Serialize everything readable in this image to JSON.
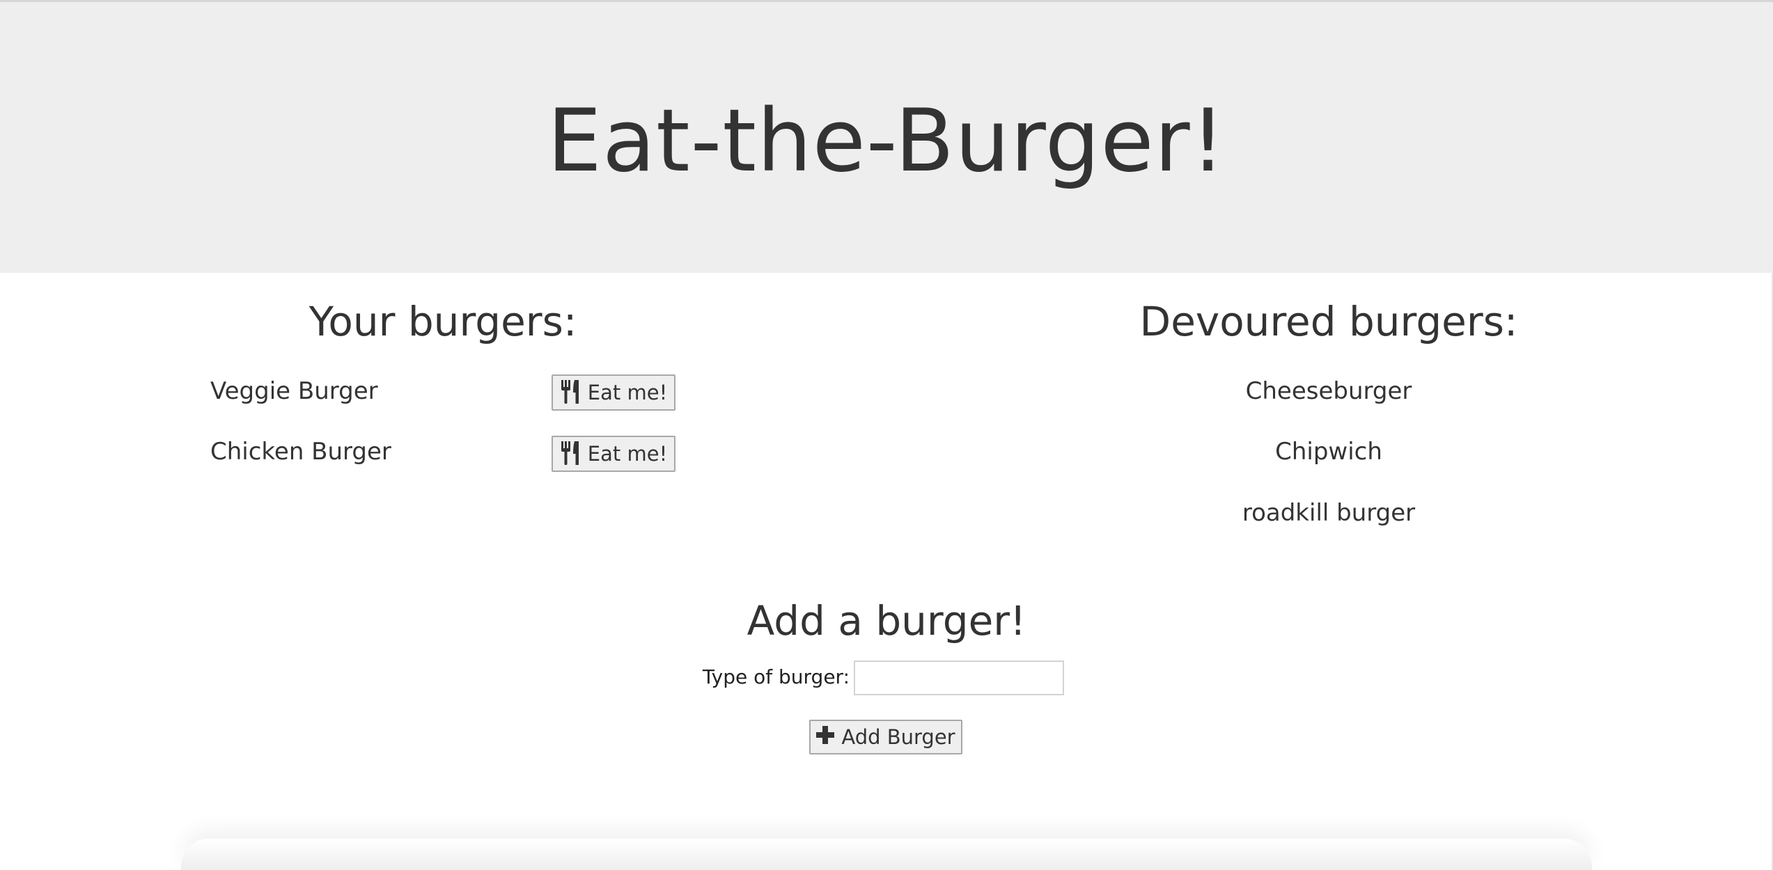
{
  "header": {
    "title": "Eat-the-Burger!"
  },
  "your_burgers": {
    "heading": "Your burgers:",
    "items": [
      {
        "name": "Veggie Burger",
        "button_label": "Eat me!",
        "button_icon": "cutlery-icon"
      },
      {
        "name": "Chicken Burger",
        "button_label": "Eat me!",
        "button_icon": "cutlery-icon"
      }
    ]
  },
  "devoured_burgers": {
    "heading": "Devoured burgers:",
    "items": [
      {
        "name": "Cheeseburger"
      },
      {
        "name": "Chipwich"
      },
      {
        "name": "roadkill burger"
      }
    ]
  },
  "add_form": {
    "heading": "Add a burger!",
    "label": "Type of burger:",
    "input_value": "",
    "input_placeholder": "",
    "button_label": "Add Burger",
    "button_icon": "plus-icon"
  },
  "colors": {
    "header_background": "#eeeeee",
    "text": "#333333",
    "button_background": "#efefef",
    "button_border": "#a8a8a8"
  }
}
